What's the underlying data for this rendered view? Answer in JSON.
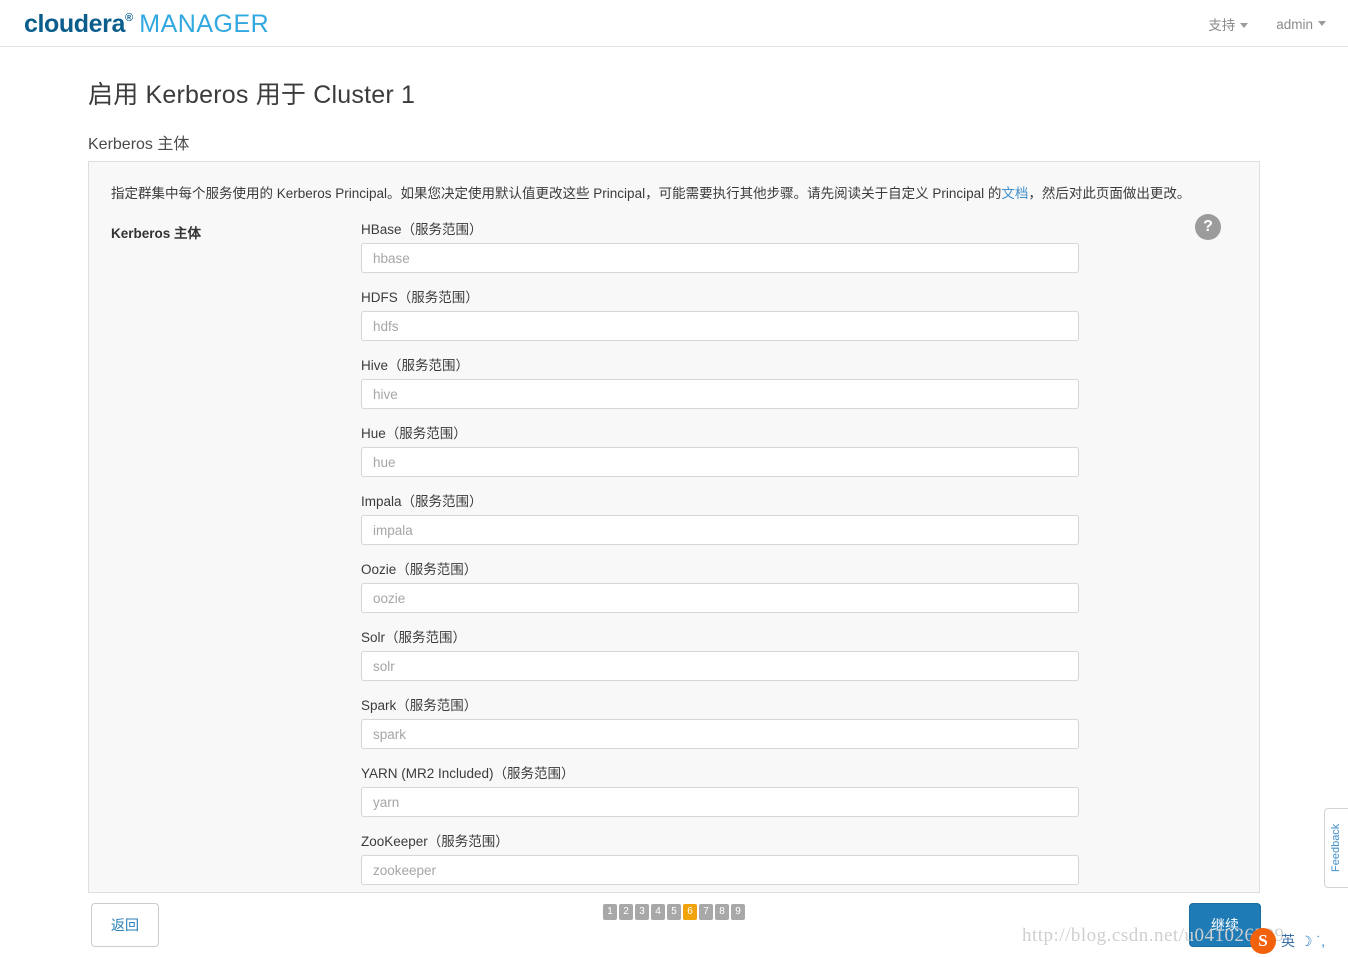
{
  "brand": {
    "name_primary": "cloudera",
    "trademark": "®",
    "name_secondary": "MANAGER"
  },
  "topnav": {
    "items": [
      {
        "label": "支持",
        "icon": "chevron-down-icon"
      },
      {
        "label": "admin",
        "icon": "chevron-down-icon"
      }
    ]
  },
  "page": {
    "title": "启用 Kerberos 用于 Cluster 1",
    "subtitle": "Kerberos 主体"
  },
  "panel": {
    "description_before_link": "指定群集中每个服务使用的 Kerberos Principal。如果您决定使用默认值更改这些 Principal，可能需要执行其他步骤。请先阅读关于自定义 Principal 的",
    "description_link": "文档",
    "description_after_link": "，然后对此页面做出更改。",
    "legend": "Kerberos 主体",
    "help_icon": "?",
    "fields": [
      {
        "label": "HBase（服务范围）",
        "value": "",
        "placeholder": "hbase",
        "name": "hbase"
      },
      {
        "label": "HDFS（服务范围）",
        "value": "",
        "placeholder": "hdfs",
        "name": "hdfs"
      },
      {
        "label": "Hive（服务范围）",
        "value": "",
        "placeholder": "hive",
        "name": "hive"
      },
      {
        "label": "Hue（服务范围）",
        "value": "",
        "placeholder": "hue",
        "name": "hue"
      },
      {
        "label": "Impala（服务范围）",
        "value": "",
        "placeholder": "impala",
        "name": "impala"
      },
      {
        "label": "Oozie（服务范围）",
        "value": "",
        "placeholder": "oozie",
        "name": "oozie"
      },
      {
        "label": "Solr（服务范围）",
        "value": "",
        "placeholder": "solr",
        "name": "solr"
      },
      {
        "label": "Spark（服务范围）",
        "value": "",
        "placeholder": "spark",
        "name": "spark"
      },
      {
        "label": "YARN (MR2 Included)（服务范围）",
        "value": "",
        "placeholder": "yarn",
        "name": "yarn"
      },
      {
        "label": "ZooKeeper（服务范围）",
        "value": "",
        "placeholder": "zookeeper",
        "name": "zookeeper"
      }
    ]
  },
  "footer": {
    "back_label": "返回",
    "continue_label": "继续",
    "pager": {
      "steps": [
        "1",
        "2",
        "3",
        "4",
        "5",
        "6",
        "7",
        "8",
        "9"
      ],
      "active_index": 5,
      "active_color": "#f0a30a",
      "inactive_color": "#a8a8a8"
    }
  },
  "feedback": {
    "label": "Feedback"
  },
  "watermark": {
    "url": "http://blog.csdn.net/u041026329",
    "ime_logo": "S",
    "ime_mode": "英",
    "ime_moon": "☽ ˙,"
  },
  "colors": {
    "brand_dark": "#0b5e8c",
    "brand_light": "#31a8e0",
    "link": "#3f8fca",
    "primary_button": "#1f7bb6",
    "panel_bg": "#f8f8f8"
  }
}
